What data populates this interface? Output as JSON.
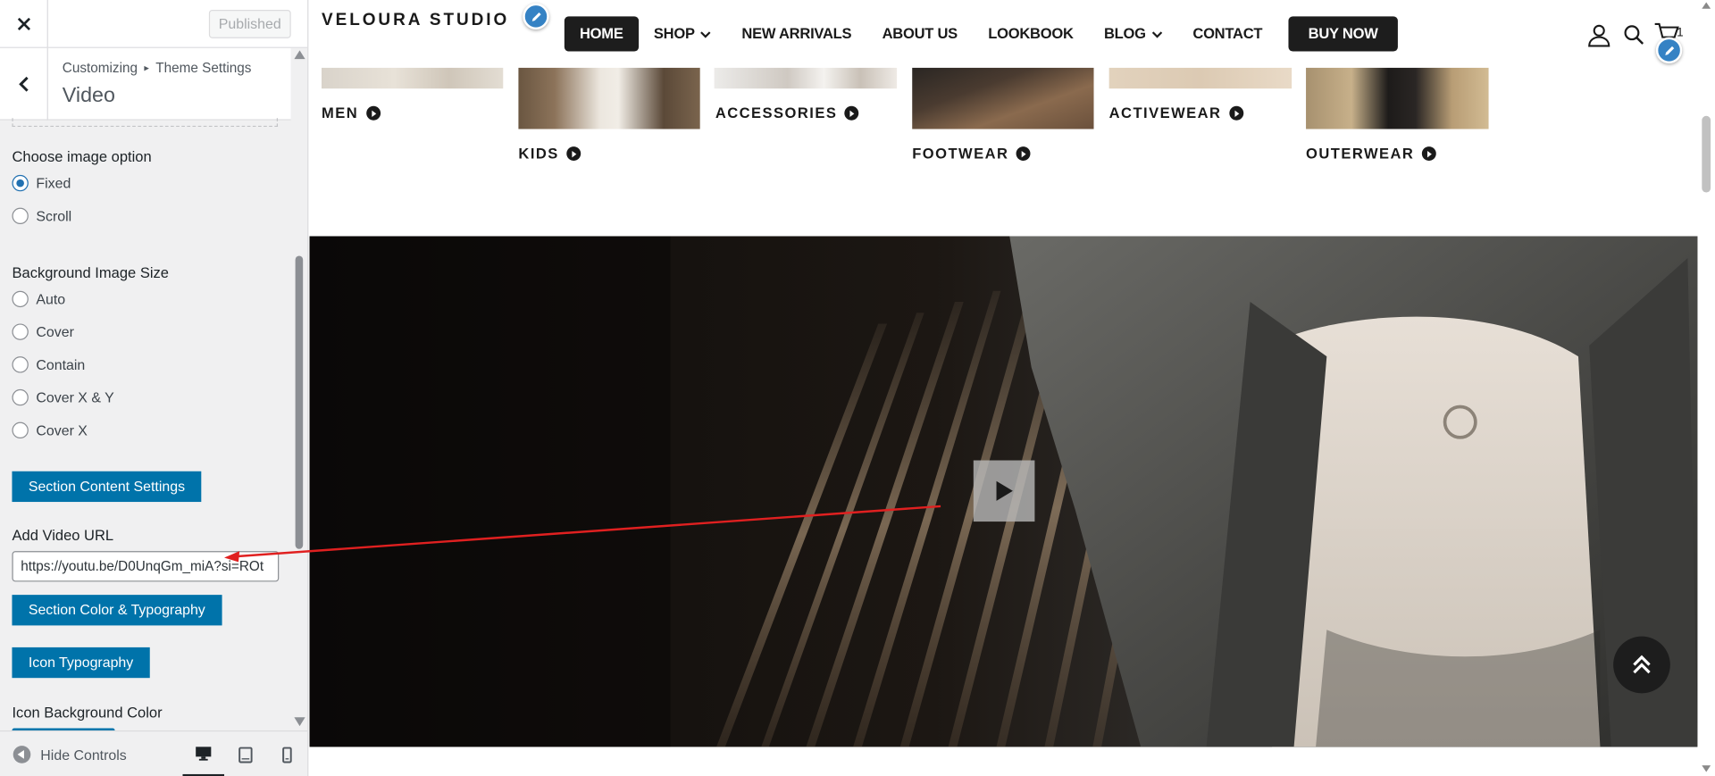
{
  "customizer": {
    "close_icon": "close-icon",
    "published_label": "Published",
    "breadcrumb": {
      "root": "Customizing",
      "separator": "▸",
      "parent": "Theme Settings"
    },
    "section_title": "Video",
    "image_option": {
      "label": "Choose image option",
      "options": [
        {
          "label": "Fixed",
          "checked": true
        },
        {
          "label": "Scroll",
          "checked": false
        }
      ]
    },
    "bg_size": {
      "label": "Background Image Size",
      "options": [
        {
          "label": "Auto",
          "checked": false
        },
        {
          "label": "Cover",
          "checked": false
        },
        {
          "label": "Contain",
          "checked": false
        },
        {
          "label": "Cover X & Y",
          "checked": false
        },
        {
          "label": "Cover X",
          "checked": false
        }
      ]
    },
    "content_settings_button": "Section Content Settings",
    "video_url": {
      "label": "Add Video URL",
      "value": "https://youtu.be/D0UnqGm_miA?si=ROt"
    },
    "color_typography_button": "Section Color & Typography",
    "icon_typography_button": "Icon Typography",
    "icon_bg_label": "Icon Background Color",
    "hide_controls_label": "Hide Controls",
    "devices": [
      "desktop",
      "tablet",
      "mobile"
    ],
    "active_device": "desktop",
    "accent_color": "#0073aa"
  },
  "site": {
    "brand": "VELOURA STUDIO",
    "nav": [
      {
        "label": "HOME",
        "active": true,
        "dropdown": false
      },
      {
        "label": "SHOP",
        "active": false,
        "dropdown": true
      },
      {
        "label": "NEW ARRIVALS",
        "active": false,
        "dropdown": false
      },
      {
        "label": "ABOUT US",
        "active": false,
        "dropdown": false
      },
      {
        "label": "LOOKBOOK",
        "active": false,
        "dropdown": false
      },
      {
        "label": "BLOG",
        "active": false,
        "dropdown": true
      },
      {
        "label": "CONTACT",
        "active": false,
        "dropdown": false
      }
    ],
    "buy_now": "BUY NOW",
    "cart_count": "1",
    "categories": [
      "MEN",
      "KIDS",
      "ACCESSORIES",
      "FOOTWEAR",
      "ACTIVEWEAR",
      "OUTERWEAR"
    ],
    "dark_color": "#1d1d1d"
  }
}
